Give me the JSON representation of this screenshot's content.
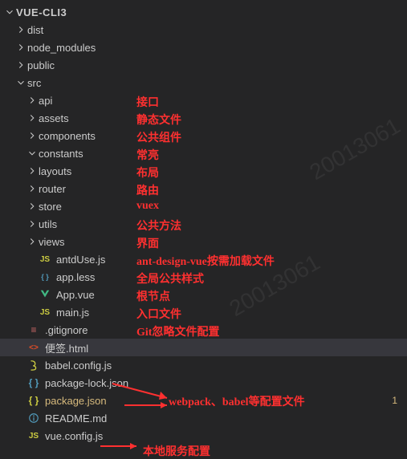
{
  "root": {
    "name": "VUE-CLI3"
  },
  "tree": [
    {
      "depth": 0,
      "type": "root",
      "open": true,
      "label": "VUE-CLI3"
    },
    {
      "depth": 1,
      "type": "folder",
      "open": false,
      "label": "dist"
    },
    {
      "depth": 1,
      "type": "folder",
      "open": false,
      "label": "node_modules"
    },
    {
      "depth": 1,
      "type": "folder",
      "open": false,
      "label": "public"
    },
    {
      "depth": 1,
      "type": "folder",
      "open": true,
      "label": "src"
    },
    {
      "depth": 2,
      "type": "folder",
      "open": false,
      "label": "api",
      "anno": "接口"
    },
    {
      "depth": 2,
      "type": "folder",
      "open": false,
      "label": "assets",
      "anno": "静态文件"
    },
    {
      "depth": 2,
      "type": "folder",
      "open": false,
      "label": "components",
      "anno": "公共组件"
    },
    {
      "depth": 2,
      "type": "folder",
      "open": true,
      "label": "constants",
      "anno": "常亮"
    },
    {
      "depth": 2,
      "type": "folder",
      "open": false,
      "label": "layouts",
      "anno": "布局"
    },
    {
      "depth": 2,
      "type": "folder",
      "open": false,
      "label": "router",
      "anno": "路由"
    },
    {
      "depth": 2,
      "type": "folder",
      "open": false,
      "label": "store",
      "anno": "vuex"
    },
    {
      "depth": 2,
      "type": "folder",
      "open": false,
      "label": "utils",
      "anno": "公共方法"
    },
    {
      "depth": 2,
      "type": "folder",
      "open": false,
      "label": "views",
      "anno": "界面"
    },
    {
      "depth": 2,
      "type": "file",
      "icon": "js",
      "label": "antdUse.js",
      "anno": "ant-design-vue按需加载文件"
    },
    {
      "depth": 2,
      "type": "file",
      "icon": "less",
      "label": "app.less",
      "anno": "全局公共样式"
    },
    {
      "depth": 2,
      "type": "file",
      "icon": "vue",
      "label": "App.vue",
      "anno": "根节点"
    },
    {
      "depth": 2,
      "type": "file",
      "icon": "js",
      "label": "main.js",
      "anno": "入口文件"
    },
    {
      "depth": 1,
      "type": "file",
      "icon": "ignore",
      "label": ".gitignore",
      "anno": "Git忽略文件配置"
    },
    {
      "depth": 1,
      "type": "file",
      "icon": "html",
      "label": "便签.html",
      "selected": true
    },
    {
      "depth": 1,
      "type": "file",
      "icon": "babel",
      "label": "babel.config.js"
    },
    {
      "depth": 1,
      "type": "file",
      "icon": "braces-blue",
      "label": "package-lock.json"
    },
    {
      "depth": 1,
      "type": "file",
      "icon": "braces",
      "label": "package.json",
      "modified": true,
      "git": "1"
    },
    {
      "depth": 1,
      "type": "file",
      "icon": "info",
      "label": "README.md"
    },
    {
      "depth": 1,
      "type": "file",
      "icon": "js",
      "label": "vue.config.js"
    }
  ],
  "annotations": {
    "webpack_babel": "webpack、babel等配置文件",
    "local_server": "本地服务配置"
  },
  "watermark": "20013061"
}
